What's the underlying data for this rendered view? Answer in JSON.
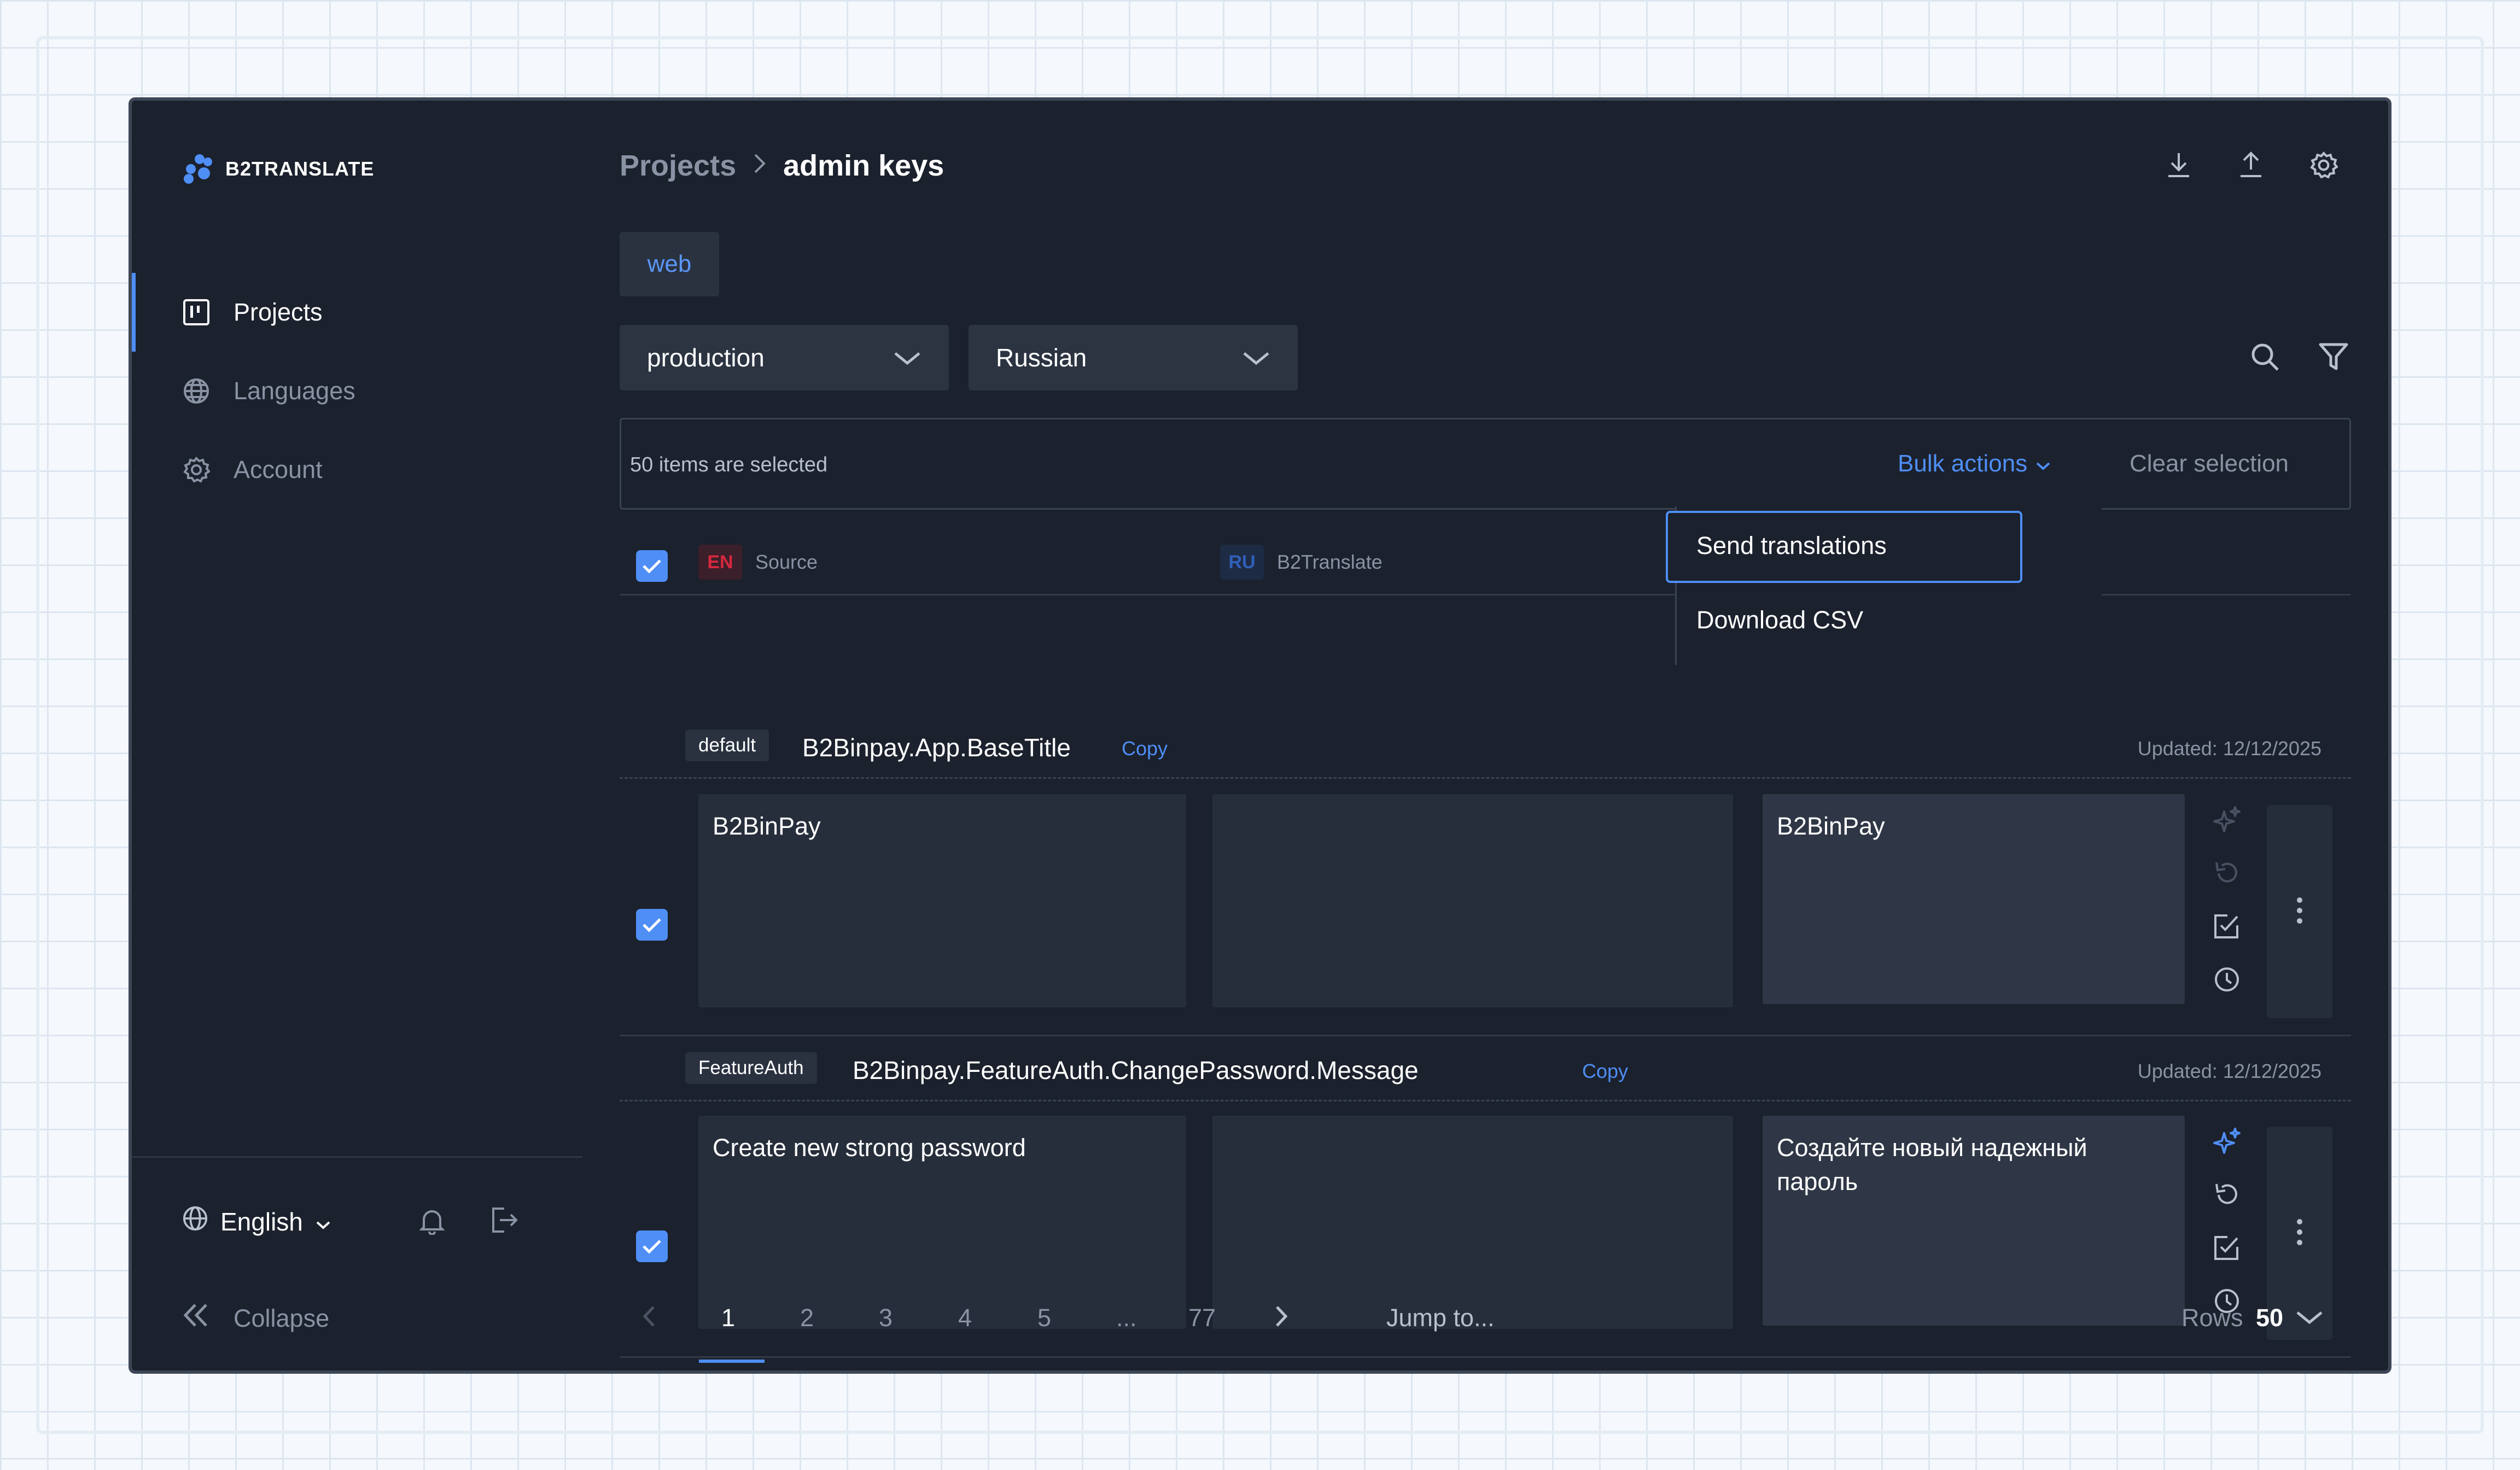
{
  "app": {
    "brand": "B2TRANSLATE",
    "accent": "#4f8ef5"
  },
  "sidebar": {
    "items": [
      {
        "label": "Projects",
        "icon": "projects-board-icon",
        "active": true
      },
      {
        "label": "Languages",
        "icon": "globe-icon",
        "active": false
      },
      {
        "label": "Account",
        "icon": "gear-icon",
        "active": false
      }
    ],
    "language": "English",
    "collapse_label": "Collapse"
  },
  "header": {
    "breadcrumb_parent": "Projects",
    "breadcrumb_current": "admin keys",
    "actions": [
      "download-icon",
      "upload-icon",
      "settings-icon"
    ]
  },
  "tabs": {
    "active": "web"
  },
  "filters": {
    "environment": "production",
    "language": "Russian"
  },
  "selection": {
    "text": "50 items are selected",
    "bulk_label": "Bulk actions",
    "clear_label": "Clear selection"
  },
  "dropdown": {
    "items": [
      "Send translations",
      "Download CSV"
    ]
  },
  "table": {
    "source_code": "EN",
    "source_label": "Source",
    "target_code": "RU",
    "target_label": "B2Translate",
    "rows": [
      {
        "namespace": "default",
        "key": "B2Binpay.App.BaseTitle",
        "copy": "Copy",
        "updated": "Updated: 12/12/2025",
        "source": "B2BinPay",
        "machine": "",
        "target": "B2BinPay"
      },
      {
        "namespace": "FeatureAuth",
        "key": "B2Binpay.FeatureAuth.ChangePassword.Message",
        "copy": "Copy",
        "updated": "Updated: 12/12/2025",
        "source": "Create new strong password",
        "machine": "",
        "target": "Создайте новый надежный пароль"
      }
    ]
  },
  "pagination": {
    "pages": [
      "1",
      "2",
      "3",
      "4",
      "5",
      "...",
      "77"
    ],
    "current": "1",
    "jump_label": "Jump to...",
    "rows_label": "Rows",
    "rows_value": "50"
  }
}
